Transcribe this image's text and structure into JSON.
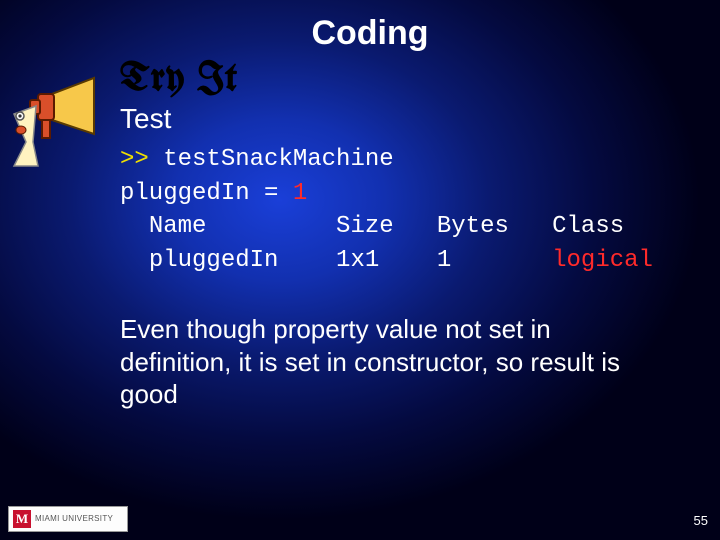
{
  "title": "Coding",
  "tryit": "Try It",
  "test": "Test",
  "code": {
    "prompt": ">> ",
    "cmd": "testSnackMachine",
    "line2a": "pluggedIn = ",
    "line2b": "1",
    "hdr_name": "Name",
    "hdr_size": "Size",
    "hdr_bytes": "Bytes",
    "hdr_class": "Class",
    "row_name": "pluggedIn",
    "row_size": "1x1",
    "row_bytes": "1",
    "row_class": "logical"
  },
  "body": "Even though property value not set in definition, it is set in constructor, so result is good",
  "page": "55",
  "logo": {
    "m": "M",
    "txt": "MIAMI UNIVERSITY"
  }
}
